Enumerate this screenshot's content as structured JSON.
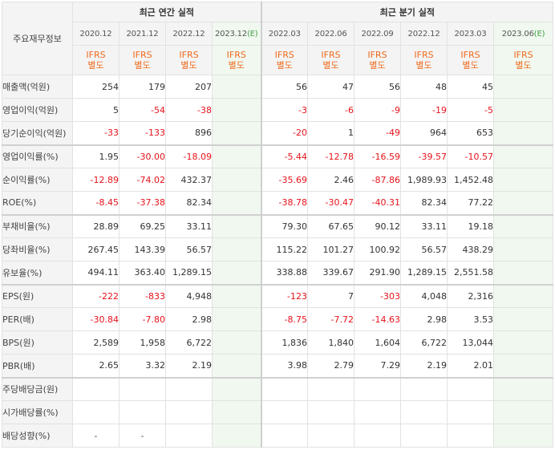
{
  "header": {
    "corner": "주요재무정보",
    "annual_title": "최근 연간 실적",
    "quarterly_title": "최근 분기 실적"
  },
  "periods": {
    "annual": [
      "2020.12",
      "2021.12",
      "2022.12",
      "2023.12"
    ],
    "annual_estimate_mark": "(E)",
    "quarterly": [
      "2022.03",
      "2022.06",
      "2022.09",
      "2022.12",
      "2023.03",
      "2023.06"
    ],
    "quarterly_estimate_mark": "(E)"
  },
  "ifrs": {
    "line1": "IFRS",
    "line2": "별도"
  },
  "rows": [
    {
      "label": "매출액(억원)",
      "annual": [
        "254",
        "179",
        "207",
        ""
      ],
      "quarterly": [
        "56",
        "47",
        "56",
        "48",
        "45",
        ""
      ]
    },
    {
      "label": "영업이익(억원)",
      "annual": [
        "5",
        "-54",
        "-38",
        ""
      ],
      "quarterly": [
        "-3",
        "-6",
        "-9",
        "-19",
        "-5",
        ""
      ]
    },
    {
      "label": "당기순이익(억원)",
      "annual": [
        "-33",
        "-133",
        "896",
        ""
      ],
      "quarterly": [
        "-20",
        "1",
        "-49",
        "964",
        "653",
        ""
      ]
    },
    {
      "label": "영업이익률(%)",
      "annual": [
        "1.95",
        "-30.00",
        "-18.09",
        ""
      ],
      "quarterly": [
        "-5.44",
        "-12.78",
        "-16.59",
        "-39.57",
        "-10.57",
        ""
      ]
    },
    {
      "label": "순이익률(%)",
      "annual": [
        "-12.89",
        "-74.02",
        "432.37",
        ""
      ],
      "quarterly": [
        "-35.69",
        "2.46",
        "-87.86",
        "1,989.93",
        "1,452.48",
        ""
      ]
    },
    {
      "label": "ROE(%)",
      "annual": [
        "-8.45",
        "-37.38",
        "82.34",
        ""
      ],
      "quarterly": [
        "-38.78",
        "-30.47",
        "-40.31",
        "82.34",
        "77.22",
        ""
      ]
    },
    {
      "label": "부채비율(%)",
      "annual": [
        "28.89",
        "69.25",
        "33.11",
        ""
      ],
      "quarterly": [
        "79.30",
        "67.65",
        "90.12",
        "33.11",
        "19.18",
        ""
      ]
    },
    {
      "label": "당좌비율(%)",
      "annual": [
        "267.45",
        "143.39",
        "56.57",
        ""
      ],
      "quarterly": [
        "115.22",
        "101.27",
        "100.92",
        "56.57",
        "438.29",
        ""
      ]
    },
    {
      "label": "유보율(%)",
      "annual": [
        "494.11",
        "363.40",
        "1,289.15",
        ""
      ],
      "quarterly": [
        "338.88",
        "339.67",
        "291.90",
        "1,289.15",
        "2,551.58",
        ""
      ]
    },
    {
      "label": "EPS(원)",
      "annual": [
        "-222",
        "-833",
        "4,948",
        ""
      ],
      "quarterly": [
        "-123",
        "7",
        "-303",
        "4,048",
        "2,316",
        ""
      ]
    },
    {
      "label": "PER(배)",
      "annual": [
        "-30.84",
        "-7.80",
        "2.98",
        ""
      ],
      "quarterly": [
        "-8.75",
        "-7.72",
        "-14.63",
        "2.98",
        "3.53",
        ""
      ]
    },
    {
      "label": "BPS(원)",
      "annual": [
        "2,589",
        "1,958",
        "6,722",
        ""
      ],
      "quarterly": [
        "1,836",
        "1,840",
        "1,604",
        "6,722",
        "13,044",
        ""
      ]
    },
    {
      "label": "PBR(배)",
      "annual": [
        "2.65",
        "3.32",
        "2.19",
        ""
      ],
      "quarterly": [
        "3.98",
        "2.79",
        "7.29",
        "2.19",
        "2.01",
        ""
      ]
    },
    {
      "label": "주당배당금(원)",
      "annual": [
        "",
        "",
        "",
        ""
      ],
      "quarterly": [
        "",
        "",
        "",
        "",
        "",
        ""
      ]
    },
    {
      "label": "시가배당률(%)",
      "annual": [
        "",
        "",
        "",
        ""
      ],
      "quarterly": [
        "",
        "",
        "",
        "",
        "",
        ""
      ]
    },
    {
      "label": "배당성향(%)",
      "annual": [
        "-",
        "-",
        "",
        ""
      ],
      "quarterly": [
        "",
        "",
        "",
        "",
        "",
        ""
      ]
    }
  ],
  "colors": {
    "negative": "#e5121b",
    "ifrs_label": "#ee6b1e",
    "estimate_bg": "#f0f8ef",
    "estimate_mark": "#46a046"
  }
}
